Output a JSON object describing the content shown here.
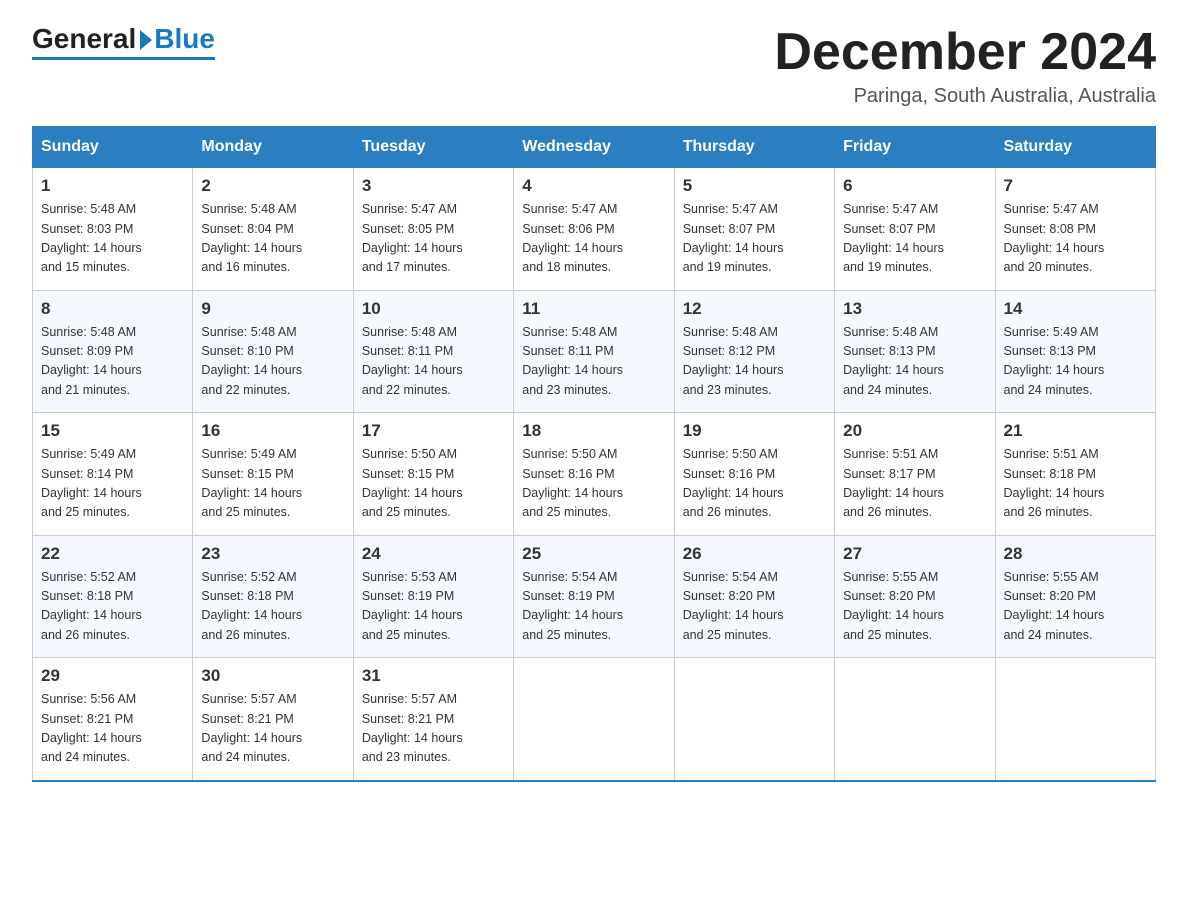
{
  "header": {
    "logo_general": "General",
    "logo_blue": "Blue",
    "month_title": "December 2024",
    "location": "Paringa, South Australia, Australia"
  },
  "weekdays": [
    "Sunday",
    "Monday",
    "Tuesday",
    "Wednesday",
    "Thursday",
    "Friday",
    "Saturday"
  ],
  "weeks": [
    [
      {
        "day": "1",
        "sunrise": "5:48 AM",
        "sunset": "8:03 PM",
        "daylight": "14 hours and 15 minutes."
      },
      {
        "day": "2",
        "sunrise": "5:48 AM",
        "sunset": "8:04 PM",
        "daylight": "14 hours and 16 minutes."
      },
      {
        "day": "3",
        "sunrise": "5:47 AM",
        "sunset": "8:05 PM",
        "daylight": "14 hours and 17 minutes."
      },
      {
        "day": "4",
        "sunrise": "5:47 AM",
        "sunset": "8:06 PM",
        "daylight": "14 hours and 18 minutes."
      },
      {
        "day": "5",
        "sunrise": "5:47 AM",
        "sunset": "8:07 PM",
        "daylight": "14 hours and 19 minutes."
      },
      {
        "day": "6",
        "sunrise": "5:47 AM",
        "sunset": "8:07 PM",
        "daylight": "14 hours and 19 minutes."
      },
      {
        "day": "7",
        "sunrise": "5:47 AM",
        "sunset": "8:08 PM",
        "daylight": "14 hours and 20 minutes."
      }
    ],
    [
      {
        "day": "8",
        "sunrise": "5:48 AM",
        "sunset": "8:09 PM",
        "daylight": "14 hours and 21 minutes."
      },
      {
        "day": "9",
        "sunrise": "5:48 AM",
        "sunset": "8:10 PM",
        "daylight": "14 hours and 22 minutes."
      },
      {
        "day": "10",
        "sunrise": "5:48 AM",
        "sunset": "8:11 PM",
        "daylight": "14 hours and 22 minutes."
      },
      {
        "day": "11",
        "sunrise": "5:48 AM",
        "sunset": "8:11 PM",
        "daylight": "14 hours and 23 minutes."
      },
      {
        "day": "12",
        "sunrise": "5:48 AM",
        "sunset": "8:12 PM",
        "daylight": "14 hours and 23 minutes."
      },
      {
        "day": "13",
        "sunrise": "5:48 AM",
        "sunset": "8:13 PM",
        "daylight": "14 hours and 24 minutes."
      },
      {
        "day": "14",
        "sunrise": "5:49 AM",
        "sunset": "8:13 PM",
        "daylight": "14 hours and 24 minutes."
      }
    ],
    [
      {
        "day": "15",
        "sunrise": "5:49 AM",
        "sunset": "8:14 PM",
        "daylight": "14 hours and 25 minutes."
      },
      {
        "day": "16",
        "sunrise": "5:49 AM",
        "sunset": "8:15 PM",
        "daylight": "14 hours and 25 minutes."
      },
      {
        "day": "17",
        "sunrise": "5:50 AM",
        "sunset": "8:15 PM",
        "daylight": "14 hours and 25 minutes."
      },
      {
        "day": "18",
        "sunrise": "5:50 AM",
        "sunset": "8:16 PM",
        "daylight": "14 hours and 25 minutes."
      },
      {
        "day": "19",
        "sunrise": "5:50 AM",
        "sunset": "8:16 PM",
        "daylight": "14 hours and 26 minutes."
      },
      {
        "day": "20",
        "sunrise": "5:51 AM",
        "sunset": "8:17 PM",
        "daylight": "14 hours and 26 minutes."
      },
      {
        "day": "21",
        "sunrise": "5:51 AM",
        "sunset": "8:18 PM",
        "daylight": "14 hours and 26 minutes."
      }
    ],
    [
      {
        "day": "22",
        "sunrise": "5:52 AM",
        "sunset": "8:18 PM",
        "daylight": "14 hours and 26 minutes."
      },
      {
        "day": "23",
        "sunrise": "5:52 AM",
        "sunset": "8:18 PM",
        "daylight": "14 hours and 26 minutes."
      },
      {
        "day": "24",
        "sunrise": "5:53 AM",
        "sunset": "8:19 PM",
        "daylight": "14 hours and 25 minutes."
      },
      {
        "day": "25",
        "sunrise": "5:54 AM",
        "sunset": "8:19 PM",
        "daylight": "14 hours and 25 minutes."
      },
      {
        "day": "26",
        "sunrise": "5:54 AM",
        "sunset": "8:20 PM",
        "daylight": "14 hours and 25 minutes."
      },
      {
        "day": "27",
        "sunrise": "5:55 AM",
        "sunset": "8:20 PM",
        "daylight": "14 hours and 25 minutes."
      },
      {
        "day": "28",
        "sunrise": "5:55 AM",
        "sunset": "8:20 PM",
        "daylight": "14 hours and 24 minutes."
      }
    ],
    [
      {
        "day": "29",
        "sunrise": "5:56 AM",
        "sunset": "8:21 PM",
        "daylight": "14 hours and 24 minutes."
      },
      {
        "day": "30",
        "sunrise": "5:57 AM",
        "sunset": "8:21 PM",
        "daylight": "14 hours and 24 minutes."
      },
      {
        "day": "31",
        "sunrise": "5:57 AM",
        "sunset": "8:21 PM",
        "daylight": "14 hours and 23 minutes."
      },
      null,
      null,
      null,
      null
    ]
  ],
  "labels": {
    "sunrise": "Sunrise:",
    "sunset": "Sunset:",
    "daylight": "Daylight:"
  }
}
